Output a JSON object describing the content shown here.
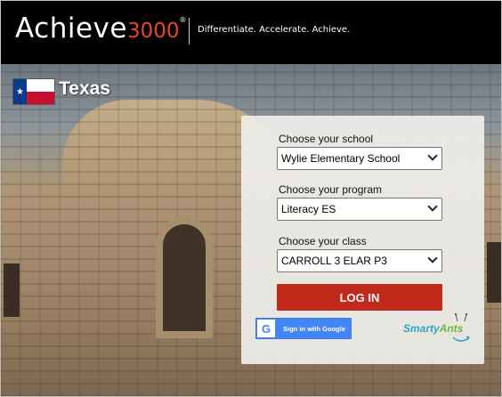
{
  "header": {
    "logo_word": "Achieve",
    "logo_number": "3000",
    "logo_mark": "®",
    "tagline": "Differentiate. Accelerate. Achieve."
  },
  "state": {
    "name": "Texas",
    "flag_icon": "texas-flag-icon"
  },
  "form": {
    "school_label": "Choose your school",
    "school_value": "Wylie Elementary School",
    "program_label": "Choose your program",
    "program_value": "Literacy ES",
    "class_label": "Choose your class",
    "class_value": "CARROLL 3 ELAR P3",
    "login_label": "LOG IN",
    "google_label": "Sign in with Google",
    "google_icon": "G"
  },
  "partner": {
    "brand_first": "Smarty",
    "brand_second": "Ants"
  },
  "colors": {
    "accent": "#e8472a",
    "login_button": "#c1291a",
    "google_blue": "#4285f4",
    "smarty_blue": "#2ba3c9",
    "ants_green": "#6bb63a"
  }
}
